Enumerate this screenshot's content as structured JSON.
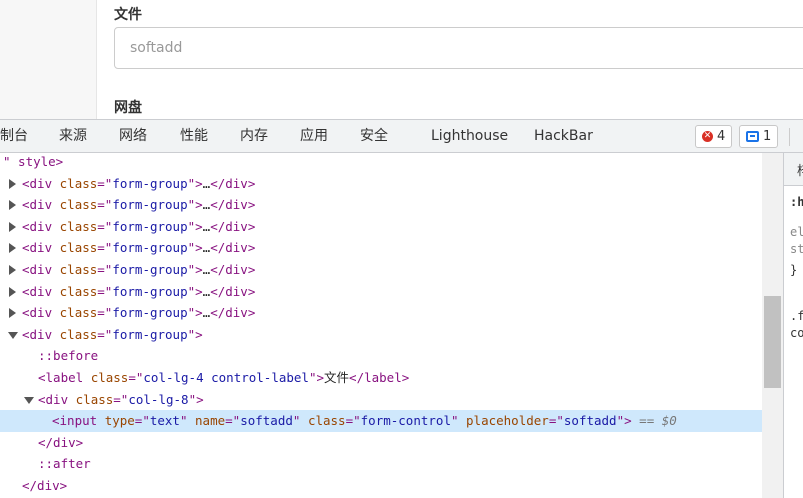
{
  "page": {
    "file_label": "文件",
    "file_placeholder": "softadd",
    "net_label": "网盘"
  },
  "toolbar": {
    "tabs": [
      "制台",
      "来源",
      "网络",
      "性能",
      "内存",
      "应用",
      "安全",
      "Lighthouse",
      "HackBar"
    ],
    "errors_count": "4",
    "messages_count": "1"
  },
  "tree": {
    "top_fragment": "\" style>",
    "collapsed_rows": [
      {
        "tag": "div",
        "attr": "class",
        "value": "form-group"
      },
      {
        "tag": "div",
        "attr": "class",
        "value": "form-group"
      },
      {
        "tag": "div",
        "attr": "class",
        "value": "form-group"
      },
      {
        "tag": "div",
        "attr": "class",
        "value": "form-group"
      },
      {
        "tag": "div",
        "attr": "class",
        "value": "form-group"
      },
      {
        "tag": "div",
        "attr": "class",
        "value": "form-group"
      },
      {
        "tag": "div",
        "attr": "class",
        "value": "form-group"
      }
    ],
    "expanded_group": {
      "tag": "div",
      "attr": "class",
      "value": "form-group"
    },
    "before": "::before",
    "label": {
      "class": "col-lg-4 control-label",
      "text": "文件"
    },
    "col_div": {
      "class": "col-lg-8"
    },
    "input": {
      "type": "text",
      "name": "softadd",
      "class": "form-control",
      "placeholder": "softadd",
      "marker": "== $0"
    },
    "close_div": "</div>",
    "after": "::after",
    "close_group": "</div>"
  },
  "styles_pane": {
    "tab_glyph": "梓",
    "hov": ":h",
    "el": "el",
    "st": "st",
    "brace": "}",
    "sel": ".f",
    "prop": "co"
  }
}
